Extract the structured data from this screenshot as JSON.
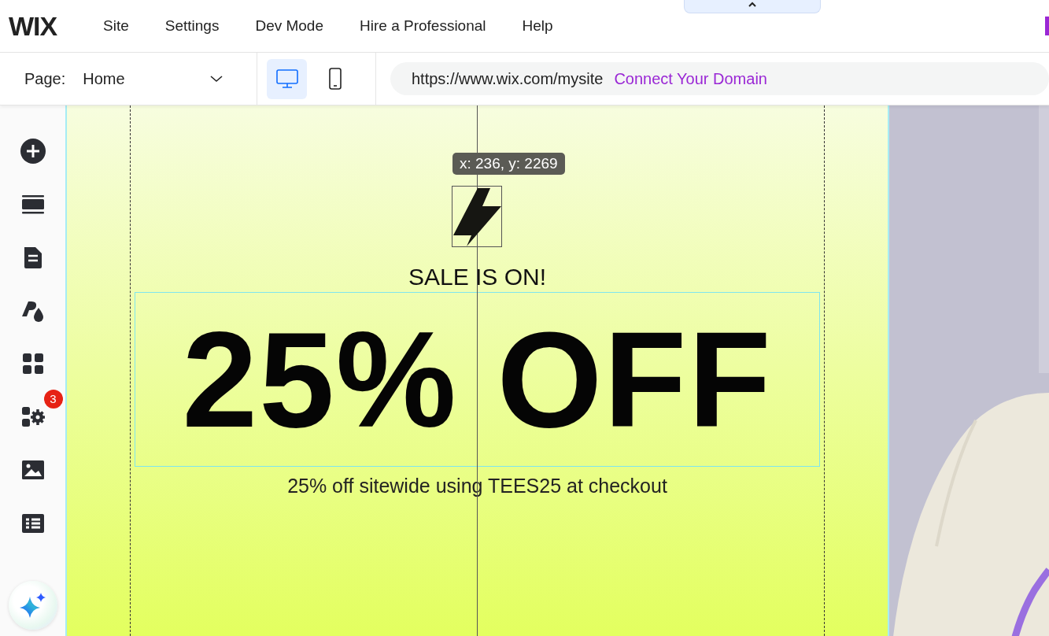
{
  "logo": "WIX",
  "menu": [
    "Site",
    "Settings",
    "Dev Mode",
    "Hire a Professional",
    "Help"
  ],
  "page_selector": {
    "label": "Page:",
    "value": "Home"
  },
  "devices": [
    {
      "kind": "desktop",
      "selected": true
    },
    {
      "kind": "mobile",
      "selected": false
    }
  ],
  "address": {
    "url": "https://www.wix.com/mysite",
    "link": "Connect Your Domain"
  },
  "sidebar": [
    {
      "kind": "add"
    },
    {
      "kind": "sections"
    },
    {
      "kind": "pages"
    },
    {
      "kind": "design"
    },
    {
      "kind": "apps"
    },
    {
      "kind": "business",
      "badge": "3"
    },
    {
      "kind": "media"
    },
    {
      "kind": "cms"
    }
  ],
  "canvas": {
    "tooltip": "x: 236, y: 2269",
    "eyebrow": "SALE IS ON!",
    "headline": "25% OFF",
    "subtitle": "25% off sitewide using TEES25 at checkout"
  }
}
